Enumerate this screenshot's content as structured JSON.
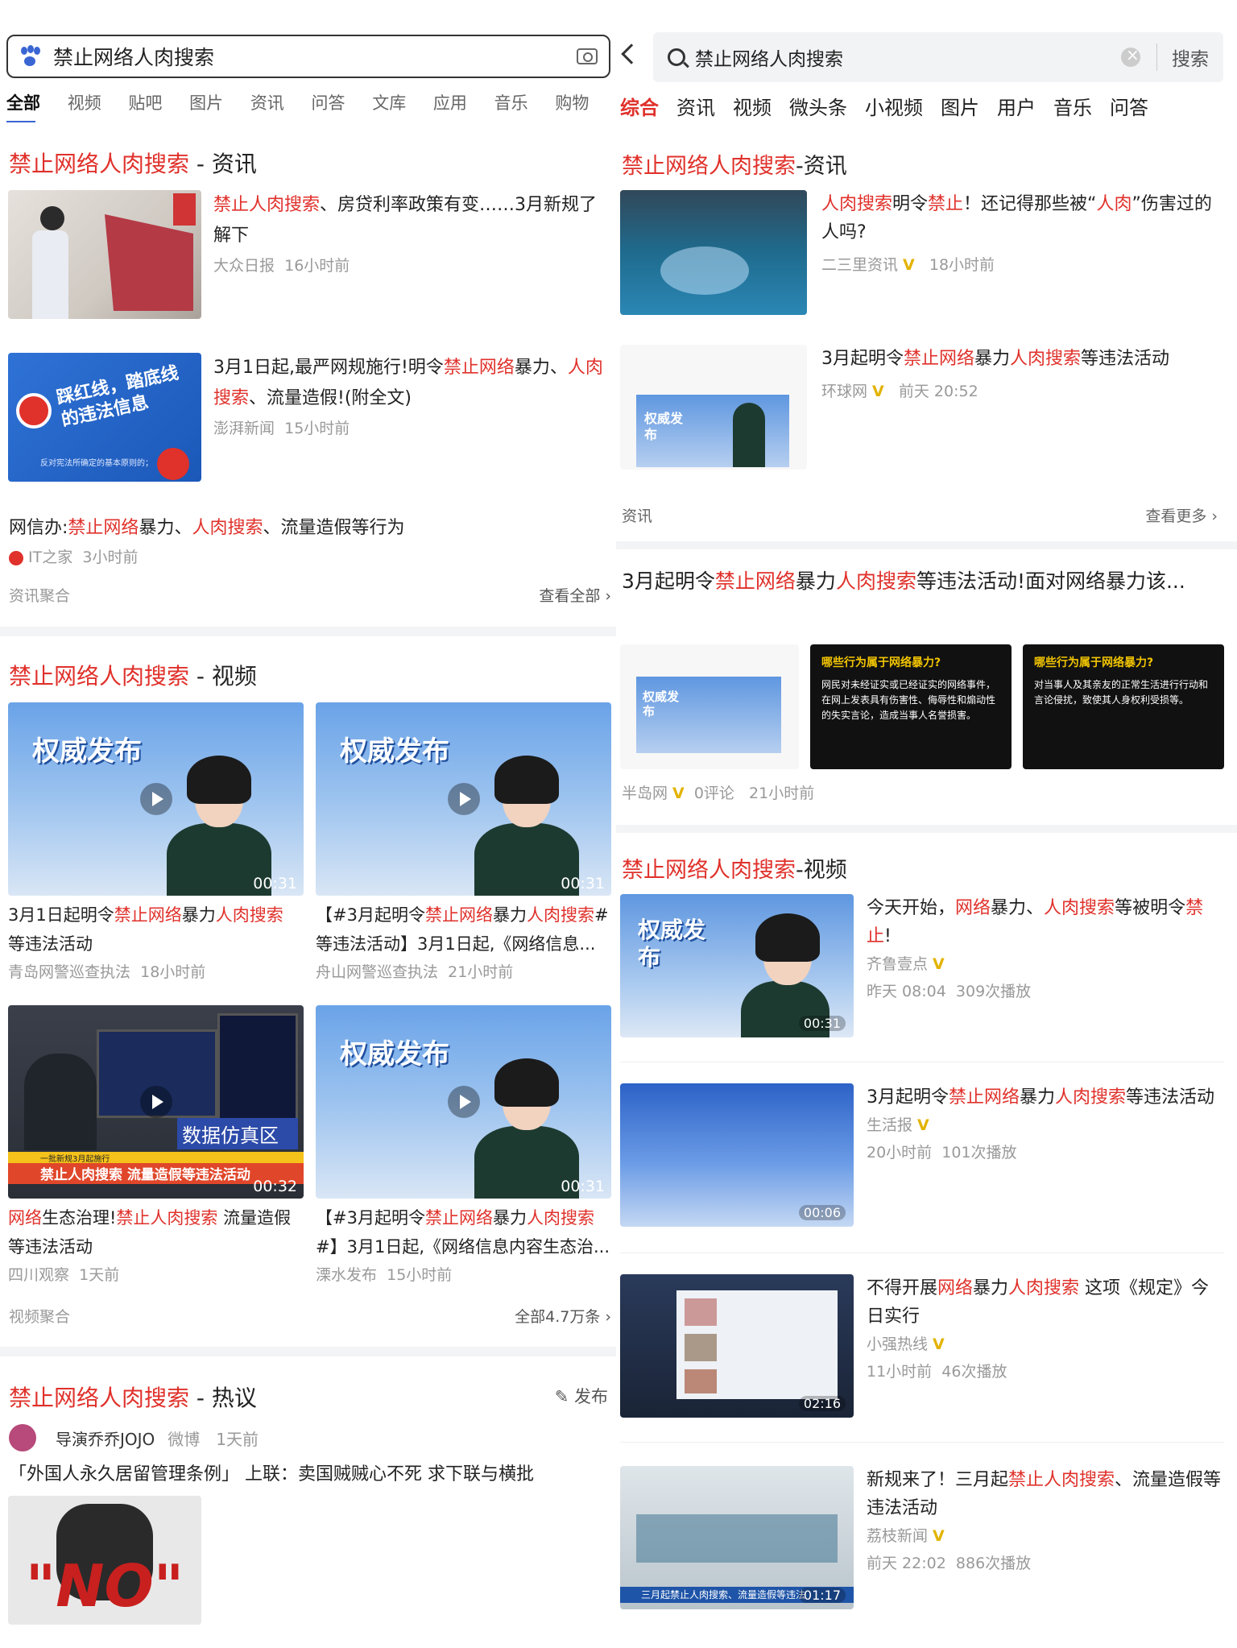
{
  "left": {
    "search": {
      "query": "禁止网络人肉搜索"
    },
    "tabs": [
      "全部",
      "视频",
      "贴吧",
      "图片",
      "资讯",
      "问答",
      "文库",
      "应用",
      "音乐",
      "购物"
    ],
    "news_section": {
      "title_hl": "禁止网络人肉搜索",
      "title_rest": " - 资讯",
      "items": [
        {
          "hl": "禁止人肉搜索",
          "rest": "、房贷利率政策有变……3月新规了解下",
          "source": "大众日报",
          "time": "16小时前"
        },
        {
          "pre": "3月1日起,最严网规施行!明令",
          "hl1": "禁止网络",
          "mid": "暴力、",
          "hl2": "人肉搜索",
          "rest": "、流量造假!(附全文)",
          "source": "澎湃新闻",
          "time": "15小时前",
          "thumb_text": "踩红线，踏底线的违法信息",
          "thumb_sub": "反对宪法所确定的基本原则的；"
        }
      ],
      "plain": {
        "pre": "网信办:",
        "hl1": "禁止网络",
        "mid": "暴力、",
        "hl2": "人肉搜索",
        "rest": "、流量造假等行为",
        "source": "IT之家",
        "time": "3小时前"
      },
      "footer_left": "资讯聚合",
      "footer_right": "查看全部"
    },
    "video_section": {
      "title_hl": "禁止网络人肉搜索",
      "title_rest": " - 视频",
      "badge": "权威发布",
      "items": [
        {
          "t1": "3月1日起明令",
          "hl1": "禁止网络",
          "t2": "暴力",
          "hl2": "人肉搜索",
          "t3": " 等违法活动",
          "source": "青岛网警巡查执法",
          "time": "18小时前",
          "dur": "00:31"
        },
        {
          "t1": "【#3月起明令",
          "hl1": "禁止网络",
          "t2": "暴力",
          "hl2": "人肉搜索",
          "t3": "#等违法活动】3月1日起,《网络信息...",
          "source": "舟山网警巡查执法",
          "time": "21小时前",
          "dur": "00:31"
        },
        {
          "t1": "",
          "hl1": "网络",
          "t2": "生态治理!",
          "hl2": "禁止人肉搜索",
          "t3": " 流量造假等违法活动",
          "source": "四川观察",
          "time": "1天前",
          "dur": "00:32",
          "banner": "禁止人肉搜索 流量造假等违法活动",
          "banner_pre": "一批新规3月起施行",
          "screen_text": "数据仿真区"
        },
        {
          "t1": "【#3月起明令",
          "hl1": "禁止网络",
          "t2": "暴力",
          "hl2": "人肉搜索",
          "t3": "#】3月1日起,《网络信息内容生态治...",
          "source": "溧水发布",
          "time": "15小时前",
          "dur": "00:31"
        }
      ],
      "footer_left": "视频聚合",
      "footer_right": "全部4.7万条"
    },
    "hot_section": {
      "title_hl": "禁止网络人肉搜索",
      "title_rest": " - 热议",
      "publish": "发布",
      "user": "导演乔乔JOJO",
      "platform": "微博",
      "time": "1天前",
      "text": "「外国人永久居留管理条例」 上联：卖国贼贼心不死 求下联与横批",
      "image_text": "\"NO\""
    }
  },
  "right": {
    "search": {
      "query": "禁止网络人肉搜索",
      "button": "搜索"
    },
    "tabs": [
      "综合",
      "资讯",
      "视频",
      "微头条",
      "小视频",
      "图片",
      "用户",
      "音乐",
      "问答"
    ],
    "news_section": {
      "title_hl": "禁止网络人肉搜索",
      "title_rest": "-资讯",
      "items": [
        {
          "hl1": "人肉搜索",
          "t1": "明令",
          "hl2": "禁止",
          "t2": "！还记得那些被“",
          "hl3": "人肉",
          "t3": "”伤害过的人吗?",
          "source": "二三里资讯",
          "time": "18小时前"
        },
        {
          "t1": "3月起明令",
          "hl1": "禁止网络",
          "t2": "暴力",
          "hl2": "人肉搜索",
          "t3": "等违法活动",
          "source": "环球网",
          "time": "前天 20:52",
          "badge": "权威发布"
        }
      ],
      "footer_left": "资讯",
      "footer_right": "查看更多"
    },
    "thread": {
      "t1": "3月起明令",
      "hl1": "禁止网络",
      "t2": "暴力",
      "hl2": "人肉搜索",
      "t3": "等违法活动!面对网络暴力该...",
      "card1_title": "哪些行为属于网络暴力?",
      "card1_body": "网民对未经证实或已经证实的网络事件，在网上发表具有伤害性、侮辱性和煽动性的失实言论，造成当事人名誉损害。",
      "card2_title": "哪些行为属于网络暴力?",
      "card2_body": "对当事人及其亲友的正常生活进行行动和言论侵扰，致使其人身权利受损等。",
      "badge": "权威发布",
      "source": "半岛网",
      "comments": "0评论",
      "time": "21小时前"
    },
    "video_section": {
      "title_hl": "禁止网络人肉搜索",
      "title_rest": "-视频",
      "badge": "权威发布",
      "items": [
        {
          "t1": "今天开始，",
          "hl1": "网络",
          "t2": "暴力、",
          "hl2": "人肉搜索",
          "t3": "等被明令",
          "hl3": "禁止",
          "t4": "!",
          "source": "齐鲁壹点",
          "time": "昨天 08:04",
          "plays": "309次播放",
          "dur": "00:31"
        },
        {
          "t1": "3月起明令",
          "hl1": "禁止网络",
          "t2": "暴力",
          "hl2": "人肉搜索",
          "t3": "等违法活动",
          "hl3": "",
          "t4": "",
          "source": "生活报",
          "time": "20小时前",
          "plays": "101次播放",
          "dur": "00:06"
        },
        {
          "t1": "不得开展",
          "hl1": "网络",
          "t2": "暴力",
          "hl2": "人肉搜索",
          "t3": " 这项《规定》今日实行",
          "hl3": "",
          "t4": "",
          "source": "小强热线",
          "time": "11小时前",
          "plays": "46次播放",
          "dur": "02:16"
        },
        {
          "t1": "新规来了！三月起",
          "hl1": "禁止人肉搜索",
          "t2": "、流量造假等违法活动",
          "hl2": "",
          "t3": "",
          "hl3": "",
          "t4": "",
          "source": "荔枝新闻",
          "time": "前天 22:02",
          "plays": "886次播放",
          "dur": "01:17",
          "banner": "三月起禁止人肉搜索、流量造假等违法"
        }
      ]
    }
  },
  "colors": {
    "highlight": "#e0312b",
    "baidu_blue": "#3a66d4",
    "verified": "#e3b300"
  }
}
